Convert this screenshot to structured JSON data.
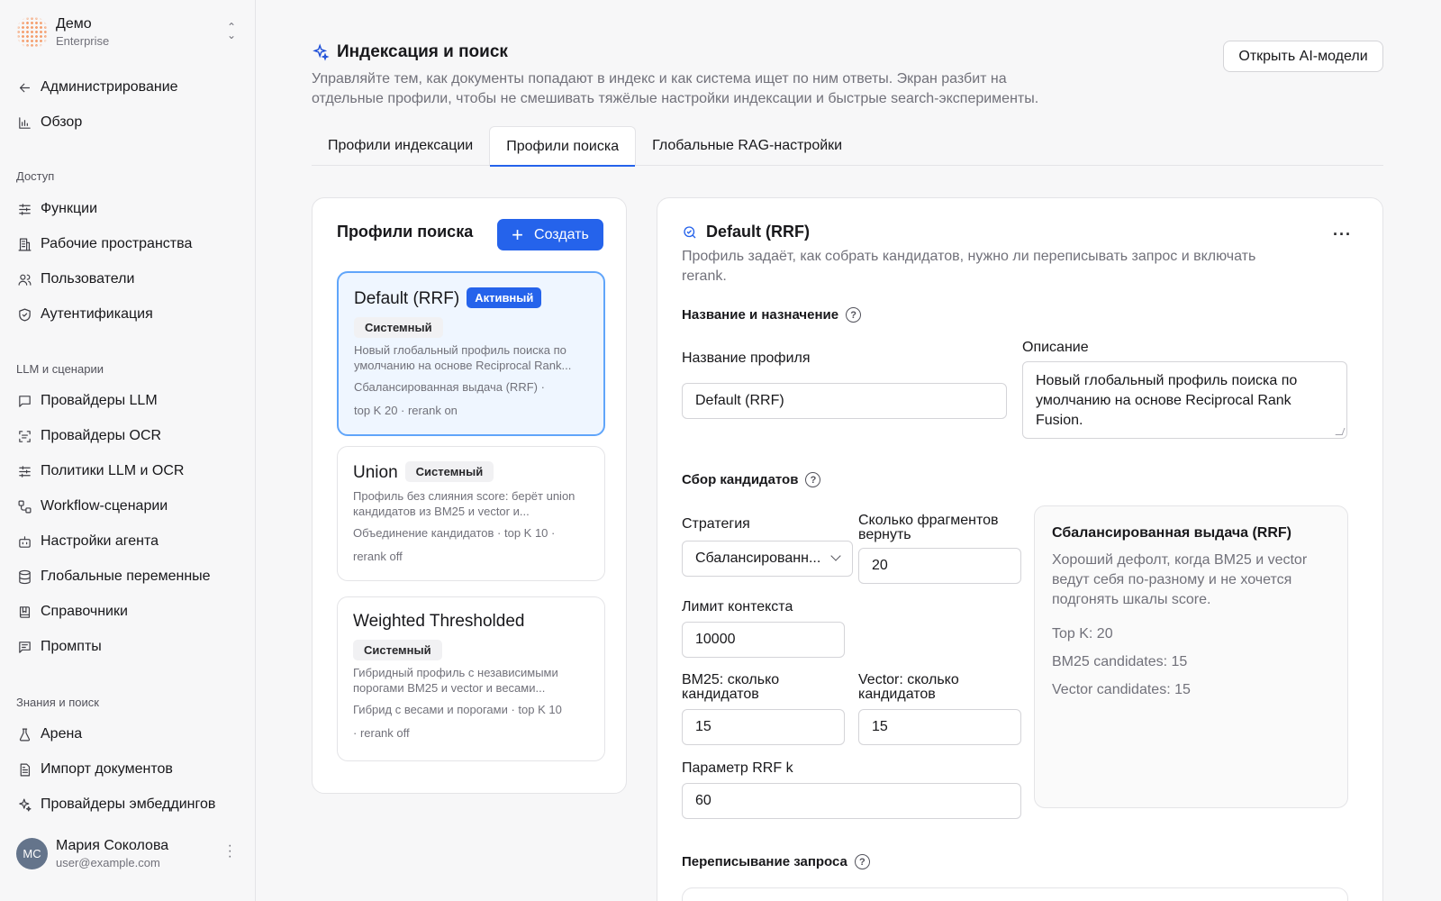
{
  "org": {
    "name": "Демо",
    "plan": "Enterprise"
  },
  "sidebar": {
    "back": "Администрирование",
    "overview": "Обзор",
    "sections": [
      {
        "title": "Доступ",
        "items": [
          "Функции",
          "Рабочие пространства",
          "Пользователи",
          "Аутентификация"
        ]
      },
      {
        "title": "LLM и сценарии",
        "items": [
          "Провайдеры LLM",
          "Провайдеры OCR",
          "Политики LLM и OCR",
          "Workflow-сценарии",
          "Настройки агента",
          "Глобальные переменные",
          "Справочники",
          "Промпты"
        ]
      },
      {
        "title": "Знания и поиск",
        "items": [
          "Арена",
          "Импорт документов",
          "Провайдеры эмбеддингов"
        ]
      }
    ]
  },
  "user": {
    "initials": "МС",
    "name": "Мария Соколова",
    "email": "user@example.com"
  },
  "page": {
    "title": "Индексация и поиск",
    "description": "Управляйте тем, как документы попадают в индекс и как система ищет по ним ответы. Экран разбит на отдельные профили, чтобы не смешивать тяжёлые настройки индексации и быстрые search-эксперименты.",
    "open_models_label": "Открыть AI-модели",
    "tabs": [
      "Профили индексации",
      "Профили поиска",
      "Глобальные RAG-настройки"
    ],
    "active_tab": 1
  },
  "profiles": {
    "title": "Профили поиска",
    "create_label": "Создать",
    "items": [
      {
        "name": "Default (RRF)",
        "active_badge": "Активный",
        "system_badge": "Системный",
        "description": "Новый глобальный профиль поиска по умолчанию на основе Reciprocal Rank...",
        "meta1": "Сбалансированная выдача (RRF)  ·",
        "meta2": "top K 20   ·   rerank on"
      },
      {
        "name": "Union",
        "system_badge": "Системный",
        "description": "Профиль без слияния score: берёт union кандидатов из BM25 и vector и...",
        "meta1": "Объединение кандидатов   ·   top K 10   ·",
        "meta2": "rerank off"
      },
      {
        "name": "Weighted Thresholded",
        "system_badge": "Системный",
        "description": "Гибридный профиль с независимыми порогами BM25 и vector и весами...",
        "meta1": "Гибрид с весами и порогами   ·   top K 10",
        "meta2": "·   rerank off"
      }
    ]
  },
  "detail": {
    "title": "Default (RRF)",
    "description": "Профиль задаёт, как собрать кандидатов, нужно ли переписывать запрос и включать rerank.",
    "section_name": "Название и назначение",
    "name_label": "Название профиля",
    "name_value": "Default (RRF)",
    "desc_label": "Описание",
    "desc_value": "Новый глобальный профиль поиска по умолчанию на основе Reciprocal Rank Fusion.",
    "section_candidates": "Сбор кандидатов",
    "strategy_label": "Стратегия",
    "strategy_value": "Сбалансированн...",
    "fragments_label": "Сколько фрагментов вернуть",
    "fragments_value": "20",
    "context_label": "Лимит контекста",
    "context_value": "10000",
    "bm25_label": "BM25: сколько кандидатов",
    "bm25_value": "15",
    "vector_label": "Vector: сколько кандидатов",
    "vector_value": "15",
    "rrf_label": "Параметр RRF k",
    "rrf_value": "60",
    "info": {
      "title": "Сбалансированная выдача (RRF)",
      "description": "Хороший дефолт, когда BM25 и vector ведут себя по-разному и не хочется подгонять шкалы score.",
      "topk": "Top K: 20",
      "bm25": "BM25 candidates: 15",
      "vector": "Vector candidates: 15"
    },
    "section_rewrite": "Переписывание запроса"
  }
}
